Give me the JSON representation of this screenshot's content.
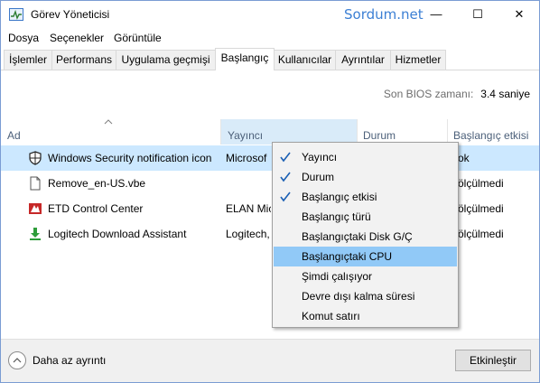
{
  "window": {
    "title": "Görev Yöneticisi",
    "watermark": "Sordum.net",
    "minimize_glyph": "—",
    "maximize_glyph": "☐",
    "close_glyph": "✕"
  },
  "menu": {
    "items": [
      "Dosya",
      "Seçenekler",
      "Görüntüle"
    ]
  },
  "tabs": [
    "İşlemler",
    "Performans",
    "Uygulama geçmişi",
    "Başlangıç",
    "Kullanıcılar",
    "Ayrıntılar",
    "Hizmetler"
  ],
  "active_tab": "Başlangıç",
  "bios": {
    "label": "Son BIOS zamanı:",
    "value": "3.4 saniye"
  },
  "columns": {
    "name": "Ad",
    "publisher": "Yayıncı",
    "status": "Durum",
    "impact": "Başlangıç etkisi"
  },
  "rows": [
    {
      "name": "Windows Security notification icon",
      "publisher": "Microsoft Corporation",
      "impact": "Düşük",
      "icon": "shield-icon",
      "selected": true
    },
    {
      "name": "Remove_en-US.vbe",
      "publisher": "",
      "impact": "Ölçülmedi",
      "icon": "script-file-icon",
      "selected": false
    },
    {
      "name": "ETD Control Center",
      "publisher": "ELAN Microelectronics Corp.",
      "impact": "Ölçülmedi",
      "icon": "etd-icon",
      "selected": false
    },
    {
      "name": "Logitech Download Assistant",
      "publisher": "Logitech, Inc.",
      "impact": "Ölçülmedi",
      "icon": "download-icon",
      "selected": false
    }
  ],
  "row_impact_visible": [
    "ok",
    "ölçülmedi",
    "ölçülmedi",
    "ölçülmedi"
  ],
  "row_publisher_visible": [
    "Microsof",
    "",
    "ELAN Mic",
    "Logitech,"
  ],
  "context_menu": {
    "items": [
      {
        "label": "Yayıncı",
        "checked": true
      },
      {
        "label": "Durum",
        "checked": true
      },
      {
        "label": "Başlangıç etkisi",
        "checked": true
      },
      {
        "label": "Başlangıç türü",
        "checked": false
      },
      {
        "label": "Başlangıçtaki Disk G/Ç",
        "checked": false
      },
      {
        "label": "Başlangıçtaki CPU",
        "checked": false,
        "highlighted": true
      },
      {
        "label": "Şimdi çalışıyor",
        "checked": false
      },
      {
        "label": "Devre dışı kalma süresi",
        "checked": false
      },
      {
        "label": "Komut satırı",
        "checked": false
      }
    ]
  },
  "footer": {
    "less_details": "Daha az ayrıntı",
    "enable_button": "Etkinleştir"
  },
  "colors": {
    "accent": "#3b7fd4",
    "selected_row": "#cce8ff",
    "menu_highlight": "#91c9f7",
    "sorted_header": "#d9ebf9"
  }
}
